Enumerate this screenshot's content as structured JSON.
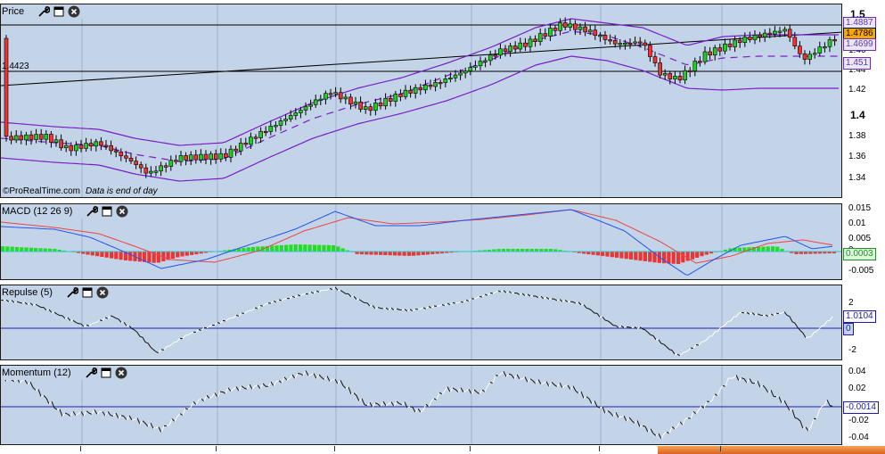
{
  "panels": {
    "price": {
      "title": "Price",
      "left_label": "1.4423",
      "watermark": "©ProRealTime.com",
      "watermark_note": "Data is end of day",
      "axis_ticks": [
        "1.5",
        "1.48",
        "1.46",
        "1.44",
        "1.42",
        "1.4",
        "1.38",
        "1.36",
        "1.34"
      ],
      "labels": [
        {
          "text": "1.4887",
          "bg": "#e8e8f8",
          "color": "#6a2fb0"
        },
        {
          "text": "1.4786",
          "bg": "#f5a800",
          "color": "#000000"
        },
        {
          "text": "1.4699",
          "bg": "#e8e8f8",
          "color": "#6a2fb0"
        },
        {
          "text": "1.451",
          "bg": "#e8e8f8",
          "color": "#6a2fb0"
        }
      ]
    },
    "macd": {
      "title": "MACD (12 26 9)",
      "axis_ticks": [
        "0.015",
        "0.01",
        "0.005",
        "0",
        "-0.005"
      ],
      "labels": [
        {
          "text": "0.0003",
          "bg": "#d9f7d9",
          "color": "#2a8a2a"
        }
      ]
    },
    "repulse": {
      "title": "Repulse (5)",
      "axis_ticks": [
        "2",
        "0",
        "-2"
      ],
      "labels": [
        {
          "text": "1.0104",
          "bg": "#ffffff",
          "color": "#1a1ab0"
        },
        {
          "text": "0",
          "bg": "#c3d3e8",
          "color": "#1a1ab0"
        }
      ]
    },
    "momentum": {
      "title": "Momentum (12)",
      "axis_ticks": [
        "0.04",
        "0.02",
        "0",
        "-0.02",
        "-0.04"
      ],
      "labels": [
        {
          "text": "-0.0014",
          "bg": "#ffffff",
          "color": "#1a1ab0"
        }
      ]
    }
  },
  "colors": {
    "panel_bg": "#c3d3e8",
    "bull": "#22cc22",
    "bear": "#ee3333",
    "band": "#7a1fc7",
    "macd_line": "#2255ee",
    "signal_line": "#ee4444"
  },
  "icons": [
    "wrench-icon",
    "window-icon",
    "close-icon"
  ]
}
